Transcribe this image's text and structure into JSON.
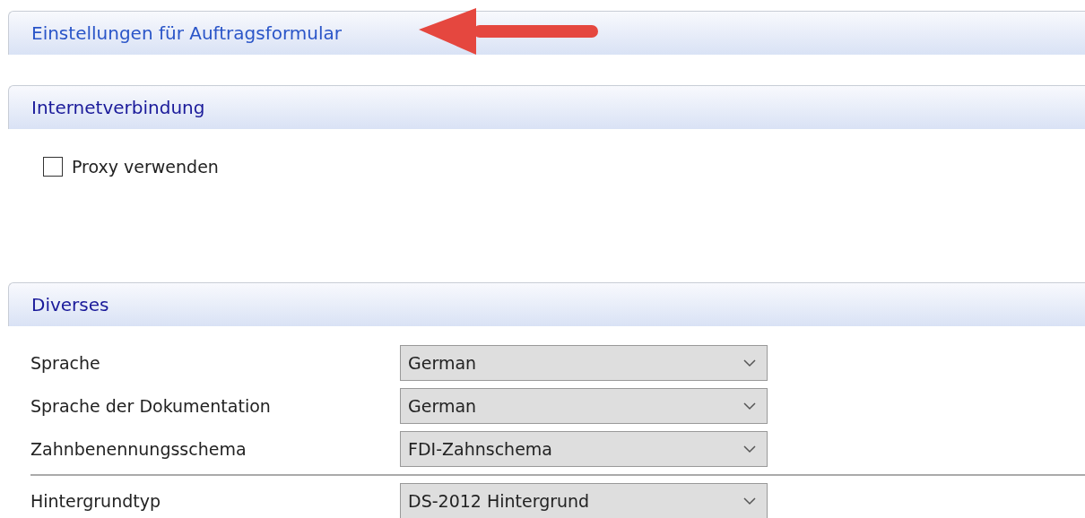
{
  "title_panel": {
    "title": "Einstellungen für Auftragsformular"
  },
  "internet": {
    "title": "Internetverbindung",
    "proxy": {
      "label": "Proxy verwenden",
      "checked": false
    }
  },
  "misc": {
    "title": "Diverses",
    "rows": [
      {
        "label": "Sprache",
        "value": "German",
        "divider_before": false
      },
      {
        "label": "Sprache der Dokumentation",
        "value": "German",
        "divider_before": false
      },
      {
        "label": "Zahnbenennungsschema",
        "value": "FDI-Zahnschema",
        "divider_before": false
      },
      {
        "label": "Hintergrundtyp",
        "value": "DS-2012 Hintergrund",
        "divider_before": true
      }
    ]
  }
}
